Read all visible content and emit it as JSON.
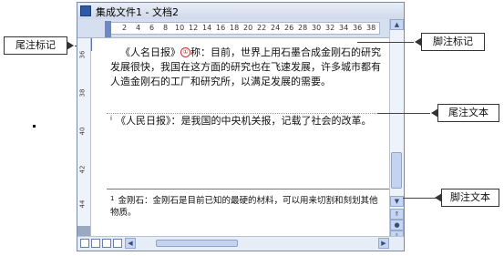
{
  "window": {
    "title": "集成文件1 - 文档2"
  },
  "ruler": {
    "ticks": [
      "2",
      "4",
      "6",
      "8",
      "10",
      "12",
      "14",
      "16",
      "18",
      "20",
      "22",
      "24",
      "26",
      "28",
      "30",
      "32",
      "34",
      "36",
      "38"
    ]
  },
  "vertical_ruler": {
    "ticks": [
      "36",
      "38",
      "40",
      "42",
      "44"
    ]
  },
  "document": {
    "body_text": "《人名日报》①称：目前，世界上用石墨合成金刚石的研究发展很快，我国在这方面的研究也在飞速发展，许多城市都有人造金刚石的工厂和研究所，以满足发展的需要。",
    "body_before": "《人名日报》",
    "footnote_marker": "①",
    "body_after": "称：目前，世界上用石墨合成金刚石的研究发展很快，我国在这方面的研究也在飞速发展，许多城市都有人造金刚石的工厂和研究所，以满足发展的需要。",
    "endnote": {
      "marker": "i",
      "text": "《人民日报》：是我国的中央机关报，记载了社会的改革。"
    },
    "footnote": {
      "marker": "1",
      "text": "金刚石：金刚石是目前已知的最硬的材料，可以用来切割和刻划其他物质。"
    }
  },
  "callouts": {
    "endnote_marker_label": "尾注标记",
    "footnote_marker_label": "脚注标记",
    "endnote_text_label": "尾注文本",
    "footnote_text_label": "脚注文本"
  }
}
